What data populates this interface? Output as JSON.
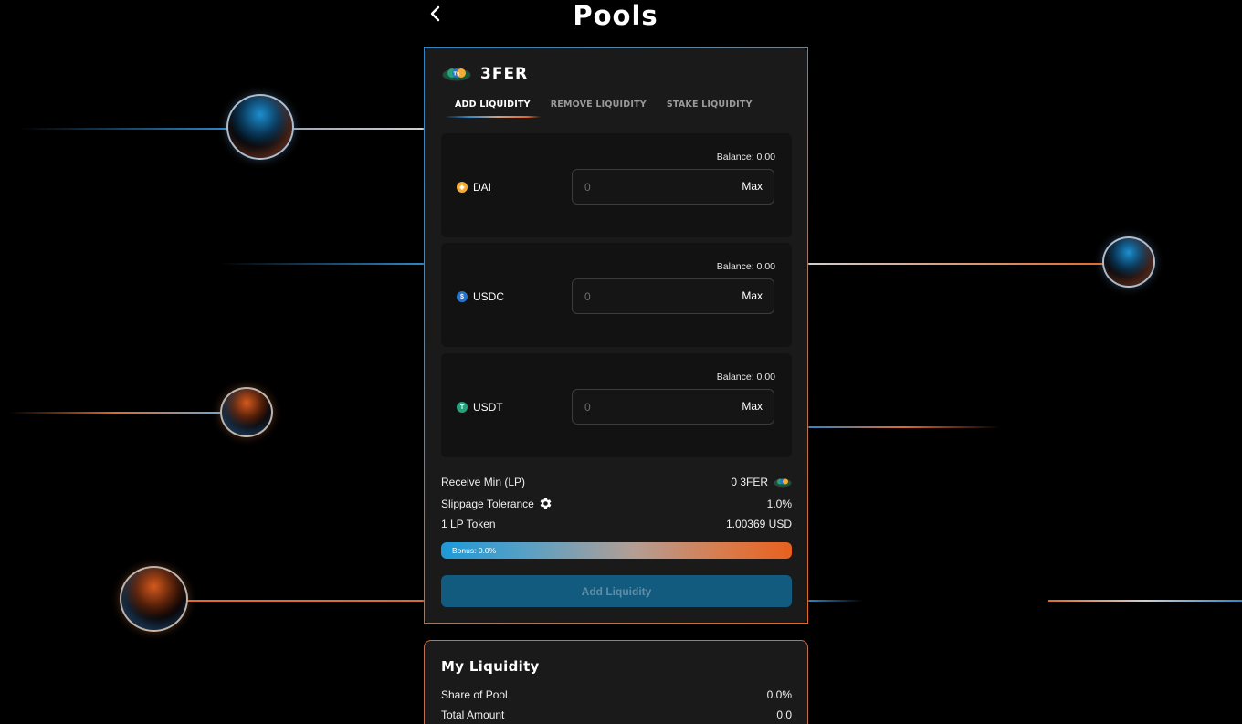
{
  "page": {
    "title": "Pools"
  },
  "pool": {
    "name": "3FER",
    "tabs": [
      {
        "label": "ADD LIQUIDITY",
        "active": true
      },
      {
        "label": "REMOVE LIQUIDITY",
        "active": false
      },
      {
        "label": "STAKE LIQUIDITY",
        "active": false
      }
    ],
    "tokens": [
      {
        "symbol": "DAI",
        "balance": "Balance: 0.00",
        "placeholder": "0",
        "max_label": "Max",
        "icon": "dai-coin-icon",
        "color": "#f5ac37"
      },
      {
        "symbol": "USDC",
        "balance": "Balance: 0.00",
        "placeholder": "0",
        "max_label": "Max",
        "icon": "usdc-coin-icon",
        "color": "#2775ca"
      },
      {
        "symbol": "USDT",
        "balance": "Balance: 0.00",
        "placeholder": "0",
        "max_label": "Max",
        "icon": "usdt-coin-icon",
        "color": "#26a17b"
      }
    ],
    "receive_min_label": "Receive Min (LP)",
    "receive_min_value": "0 3FER",
    "slippage_label": "Slippage Tolerance",
    "slippage_value": "1.0%",
    "lp_token_label": "1 LP Token",
    "lp_token_value": "1.00369 USD",
    "bonus_label": "Bonus: 0.0%",
    "bonus_percent": 0,
    "add_button_label": "Add Liquidity"
  },
  "my_liquidity": {
    "title": "My Liquidity",
    "share_label": "Share of Pool",
    "share_value": "0.0%",
    "total_label": "Total Amount",
    "total_value": "0.0"
  },
  "colors": {
    "accent_blue": "#2f86c6",
    "accent_orange": "#e06a2a",
    "button_bg": "#125b7e",
    "card_bg": "#1a1a1b"
  }
}
